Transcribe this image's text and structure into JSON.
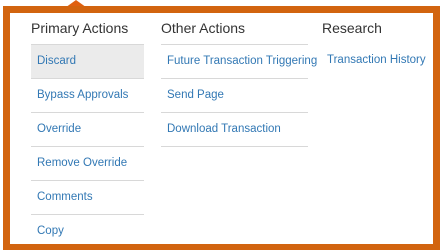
{
  "colors": {
    "accent_border": "#d2640f",
    "link": "#3278b4",
    "header_text": "#333333",
    "selected_bg": "#ebebeb"
  },
  "menu": {
    "primary": {
      "header": "Primary Actions",
      "items": [
        {
          "label": "Discard",
          "selected": true
        },
        {
          "label": "Bypass Approvals"
        },
        {
          "label": "Override"
        },
        {
          "label": "Remove Override"
        },
        {
          "label": "Comments"
        },
        {
          "label": "Copy"
        }
      ]
    },
    "other": {
      "header": "Other Actions",
      "items": [
        {
          "label": "Future Transaction Triggering"
        },
        {
          "label": "Send Page"
        },
        {
          "label": "Download Transaction"
        }
      ]
    },
    "research": {
      "header": "Research",
      "items": [
        {
          "label": "Transaction History"
        }
      ]
    }
  }
}
